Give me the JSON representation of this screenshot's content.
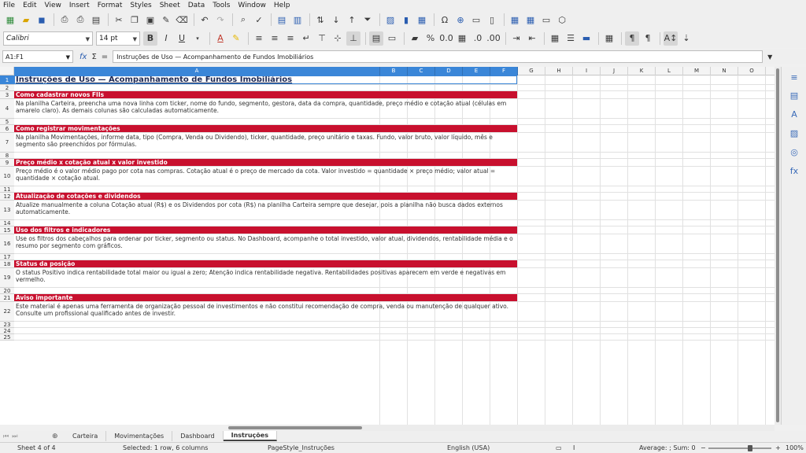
{
  "menu": [
    "File",
    "Edit",
    "View",
    "Insert",
    "Format",
    "Styles",
    "Sheet",
    "Data",
    "Tools",
    "Window",
    "Help"
  ],
  "formatting": {
    "font_name": "Calibri",
    "font_size": "14 pt"
  },
  "formula_bar": {
    "name_box": "A1:F1",
    "fx_symbol": "fx",
    "sum_symbol": "Σ",
    "equals_symbol": "=",
    "content": "Instruções de Uso — Acompanhamento de Fundos Imobiliários"
  },
  "columns": [
    "A",
    "B",
    "C",
    "D",
    "E",
    "F",
    "G",
    "H",
    "I",
    "J",
    "K",
    "L",
    "M",
    "N",
    "O",
    "P"
  ],
  "rows": [
    "1",
    "2",
    "3",
    "4",
    "5",
    "6",
    "7",
    "8",
    "9",
    "10",
    "11",
    "12",
    "13",
    "14",
    "15",
    "16",
    "17",
    "18",
    "19",
    "20",
    "21",
    "22",
    "23",
    "24",
    "25"
  ],
  "content": {
    "title": "Instruções de Uso — Acompanhamento de Fundos Imobiliários",
    "sections": [
      {
        "heading": "Como cadastrar novos FIIs",
        "body": "Na planilha Carteira, preencha uma nova linha com ticker, nome do fundo, segmento, gestora, data da compra, quantidade, preço médio e cotação atual (células em amarelo claro). As demais colunas são calculadas automaticamente."
      },
      {
        "heading": "Como registrar movimentações",
        "body": "Na planilha Movimentações, informe data, tipo (Compra, Venda ou Dividendo), ticker, quantidade, preço unitário e taxas. Fundo, valor bruto, valor líquido, mês e segmento são preenchidos por fórmulas."
      },
      {
        "heading": "Preço médio x cotação atual x valor investido",
        "body": "Preço médio é o valor médio pago por cota nas compras. Cotação atual é o preço de mercado da cota. Valor investido = quantidade × preço médio; valor atual = quantidade × cotação atual."
      },
      {
        "heading": "Atualização de cotações e dividendos",
        "body": "Atualize manualmente a coluna Cotação atual (R$) e os Dividendos por cota (R$) na planilha Carteira sempre que desejar, pois a planilha não busca dados externos automaticamente."
      },
      {
        "heading": "Uso dos filtros e indicadores",
        "body": "Use os filtros dos cabeçalhos para ordenar por ticker, segmento ou status. No Dashboard, acompanhe o total investido, valor atual, dividendos, rentabilidade média e o resumo por segmento com gráficos."
      },
      {
        "heading": "Status da posição",
        "body": "O status Positivo indica rentabilidade total maior ou igual a zero; Atenção indica rentabilidade negativa. Rentabilidades positivas aparecem em verde e negativas em vermelho."
      },
      {
        "heading": "Aviso importante",
        "body": "Este material é apenas uma ferramenta de organização pessoal de investimentos e não constitui recomendação de compra, venda ou manutenção de qualquer ativo. Consulte um profissional qualificado antes de investir."
      }
    ]
  },
  "sheet_tabs": [
    {
      "label": "Carteira",
      "active": false
    },
    {
      "label": "Movimentações",
      "active": false
    },
    {
      "label": "Dashboard",
      "active": false
    },
    {
      "label": "Instruções",
      "active": true
    }
  ],
  "status": {
    "sheet": "Sheet 4 of 4",
    "selection": "Selected: 1 row, 6 columns",
    "page_style": "PageStyle_Instruções",
    "language": "English (USA)",
    "summary": "Average: ; Sum: 0",
    "zoom": "100%"
  },
  "colors": {
    "section_fill": "#c8102e",
    "title_text": "#1e2a55",
    "selection": "#3a86d8"
  }
}
